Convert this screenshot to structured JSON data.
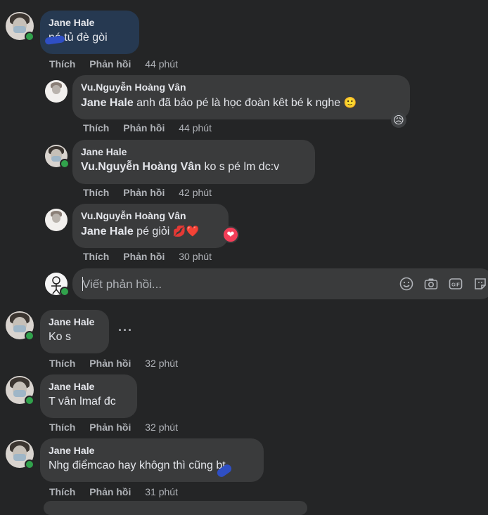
{
  "comments": [
    {
      "author": "Jane Hale",
      "text": "nó tủ đè gòi",
      "like": "Thích",
      "reply": "Phản hồi",
      "time": "44 phút"
    },
    {
      "author": "Vu.Nguyễn Hoàng Vân",
      "tag": "Jane Hale",
      "text": "anh đã bảo pé là học đoàn kêt bé k nghe",
      "emoji": "🙂",
      "reaction": "😥",
      "like": "Thích",
      "reply": "Phản hồi",
      "time": "44 phút"
    },
    {
      "author": "Jane Hale",
      "tag": "Vu.Nguyễn Hoàng Vân",
      "text": "ko s pé lm dc:v",
      "like": "Thích",
      "reply": "Phản hồi",
      "time": "42 phút"
    },
    {
      "author": "Vu.Nguyễn Hoàng Vân",
      "tag": "Jane Hale",
      "text": "pé giỏi",
      "emoji": "💋❤️",
      "reaction": "❤",
      "like": "Thích",
      "reply": "Phản hồi",
      "time": "30 phút"
    },
    {
      "author": "Jane Hale",
      "text": "Ko s",
      "more": "···",
      "like": "Thích",
      "reply": "Phản hồi",
      "time": "32 phút"
    },
    {
      "author": "Jane Hale",
      "text": "T vân lmaf đc",
      "like": "Thích",
      "reply": "Phản hồi",
      "time": "32 phút"
    },
    {
      "author": "Jane Hale",
      "text": "Nhg điểmcao hay khôgn thì cũng bt",
      "like": "Thích",
      "reply": "Phản hồi",
      "time": "31 phút"
    }
  ],
  "reply_box": {
    "placeholder": "Viết phản hồi...",
    "icons": [
      "smiley-icon",
      "camera-icon",
      "gif-icon",
      "sticker-icon"
    ]
  },
  "colors": {
    "background": "#242526",
    "bubble": "#3a3b3c",
    "highlight_bubble": "#263951",
    "online": "#31a24c",
    "meta": "#b0b3b8"
  }
}
